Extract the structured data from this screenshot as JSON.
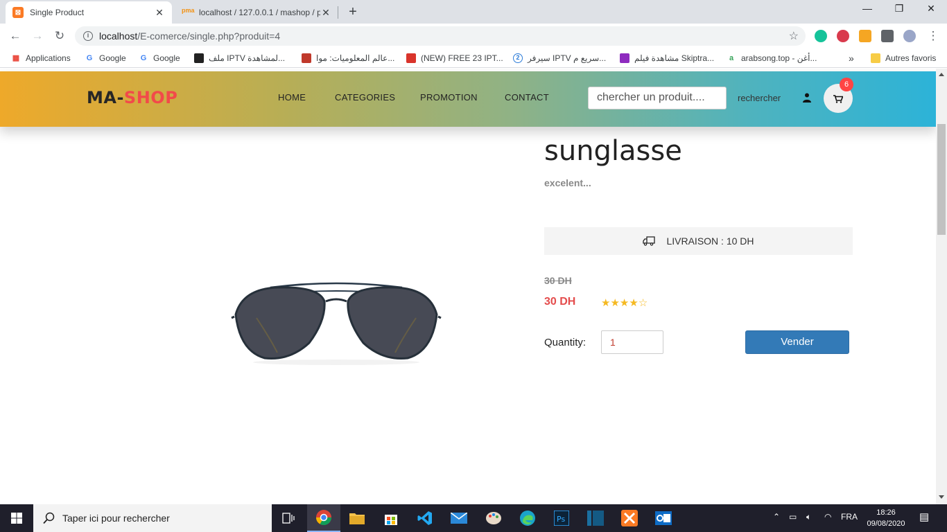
{
  "browser": {
    "tabs": [
      {
        "title": "Single Product",
        "close": "✕"
      },
      {
        "title": "localhost / 127.0.0.1 / mashop / p",
        "close": "✕"
      }
    ],
    "new_tab": "+",
    "window_controls": {
      "minimize": "—",
      "maximize": "❐",
      "close": "✕"
    },
    "url_host": "localhost",
    "url_path": "/E-comerce/single.php?produit=4",
    "bookmarks": [
      "Applications",
      "Google",
      "Google",
      "ملف IPTV لمشاهدة...",
      "عالم المعلوميات: موا...",
      "(NEW) FREE 23 IPT...",
      "سيرفر IPTV سريع م...",
      "مشاهدة فيلم Skiptra...",
      "arabsong.top - أغن...",
      "Autres favoris"
    ],
    "bookmarks_more": "»"
  },
  "site": {
    "logo_part1": "MA-",
    "logo_part2": "SHOP",
    "nav": [
      "HOME",
      "CATEGORIES",
      "PROMOTION",
      "CONTACT"
    ],
    "search_placeholder": "chercher un produit....",
    "search_button": "rechercher",
    "cart_count": "6"
  },
  "product": {
    "title": "sunglasse",
    "description": "excelent...",
    "delivery": "LIVRAISON : 10 DH",
    "old_price": "30 DH",
    "price": "30 DH",
    "rating": 4,
    "rating_max": 5,
    "quantity_label": "Quantity:",
    "quantity_value": "1",
    "buy_button": "Vender"
  },
  "taskbar": {
    "search_placeholder": "Taper ici pour rechercher",
    "language": "FRA",
    "time": "18:26",
    "date": "09/08/2020"
  },
  "colors": {
    "logo_accent": "#f24a4a",
    "price": "#e44c4c",
    "buy_button": "#337ab7",
    "stars": "#f5b921",
    "cart_badge": "#ff4444"
  }
}
